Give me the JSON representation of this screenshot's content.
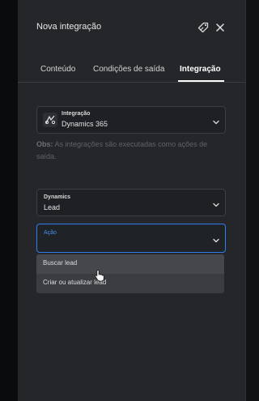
{
  "panel": {
    "title": "Nova integração",
    "icons": [
      "tag-icon",
      "close-icon"
    ]
  },
  "tabs": [
    {
      "label": "Conteúdo",
      "active": false
    },
    {
      "label": "Condições de saída",
      "active": false
    },
    {
      "label": "Integração",
      "active": true
    }
  ],
  "integration_select": {
    "label": "Integração",
    "value": "Dynamics 365",
    "icon": "dynamics-logo-icon"
  },
  "obs": {
    "prefix": "Obs:",
    "text": "As integrações são executadas como ações de saída."
  },
  "entity_select": {
    "label": "Dynamics",
    "value": "Lead"
  },
  "action_select": {
    "label": "Ação",
    "value": "",
    "focused_color": "#2f7ff0"
  },
  "dropdown": {
    "options": [
      "Buscar lead",
      "Criar ou atualizar lead"
    ],
    "hovered_index": 0
  },
  "colors": {
    "panel_bg": "#242629",
    "accent": "#2f7ff0"
  }
}
